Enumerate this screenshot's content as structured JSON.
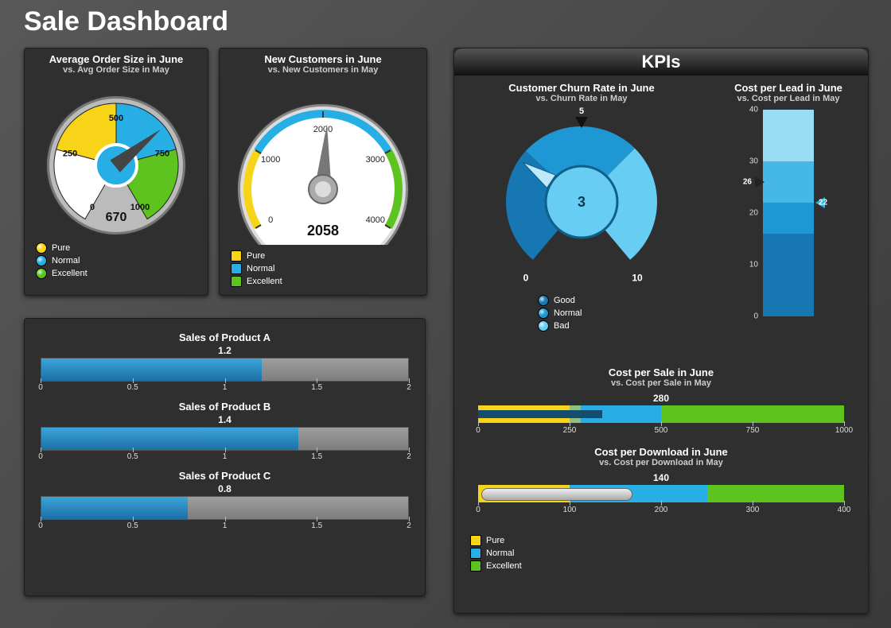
{
  "title": "Sale Dashboard",
  "colors": {
    "pure": "#f7d417",
    "normal": "#27aee5",
    "excellent": "#5cc31f",
    "good": "#1777b2",
    "normal2": "#1f97d4",
    "bad": "#67cdf2"
  },
  "gauge_order": {
    "title": "Average Order Size in June",
    "subtitle": "vs. Avg Order Size in May",
    "min": 0,
    "max": 1000,
    "ticks": [
      0,
      250,
      500,
      750,
      1000
    ],
    "value": 670,
    "bands": [
      {
        "from": 0,
        "to": 250,
        "level": "none"
      },
      {
        "from": 250,
        "to": 500,
        "level": "pure"
      },
      {
        "from": 500,
        "to": 750,
        "level": "normal"
      },
      {
        "from": 750,
        "to": 1000,
        "level": "excellent"
      }
    ],
    "legend": [
      "Pure",
      "Normal",
      "Excellent"
    ]
  },
  "gauge_customers": {
    "title": "New Customers in June",
    "subtitle": "vs. New Customers in May",
    "min": 0,
    "max": 4000,
    "ticks": [
      0,
      1000,
      2000,
      3000,
      4000
    ],
    "value": 2058,
    "bands": [
      {
        "from": 0,
        "to": 1000,
        "level": "pure"
      },
      {
        "from": 1000,
        "to": 3000,
        "level": "normal"
      },
      {
        "from": 3000,
        "to": 4000,
        "level": "excellent"
      }
    ],
    "legend": [
      "Pure",
      "Normal",
      "Excellent"
    ]
  },
  "products": {
    "max": 2,
    "ticks": [
      0,
      0.5,
      1,
      1.5,
      2
    ],
    "items": [
      {
        "name": "Sales of Product A",
        "value": 1.2
      },
      {
        "name": "Sales of Product B",
        "value": 1.4
      },
      {
        "name": "Sales of Product C",
        "value": 0.8
      }
    ]
  },
  "kpi": {
    "title": "KPIs",
    "churn": {
      "title": "Customer Churn Rate in June",
      "subtitle": "vs. Churn Rate in May",
      "min": 0,
      "max": 10,
      "ticks": [
        0,
        5,
        10
      ],
      "value": 3,
      "bands": [
        {
          "from": 0,
          "to": 3.3,
          "level": "good"
        },
        {
          "from": 3.3,
          "to": 6.6,
          "level": "normal2"
        },
        {
          "from": 6.6,
          "to": 10,
          "level": "bad"
        }
      ],
      "legend": [
        "Good",
        "Normal",
        "Bad"
      ]
    },
    "cost_lead": {
      "title": "Cost per Lead in June",
      "subtitle": "vs. Cost per Lead in May",
      "min": 0,
      "max": 40,
      "ticks": [
        0,
        10,
        20,
        30,
        40
      ],
      "left_marker": 26,
      "right_marker": 22,
      "bands": [
        {
          "from": 0,
          "to": 16,
          "color": "#1777b2"
        },
        {
          "from": 16,
          "to": 22,
          "color": "#1f97d4"
        },
        {
          "from": 22,
          "to": 30,
          "color": "#45b8e8"
        },
        {
          "from": 30,
          "to": 40,
          "color": "#9adcf4"
        }
      ]
    },
    "cost_sale": {
      "title": "Cost per Sale in June",
      "subtitle": "vs. Cost per Sale in May",
      "min": 0,
      "max": 1000,
      "ticks": [
        0,
        250,
        500,
        750,
        1000
      ],
      "value": 280,
      "bar_value": 340,
      "bands": [
        {
          "from": 0,
          "to": 250,
          "level": "pure"
        },
        {
          "from": 250,
          "to": 500,
          "level": "normal"
        },
        {
          "from": 500,
          "to": 1000,
          "level": "excellent"
        }
      ]
    },
    "cost_download": {
      "title": "Cost per Download in June",
      "subtitle": "vs. Cost per Download in May",
      "min": 0,
      "max": 400,
      "ticks": [
        0,
        100,
        200,
        300,
        400
      ],
      "value": 140,
      "bar_value": 170,
      "bands": [
        {
          "from": 0,
          "to": 100,
          "level": "pure"
        },
        {
          "from": 100,
          "to": 250,
          "level": "normal"
        },
        {
          "from": 250,
          "to": 400,
          "level": "excellent"
        }
      ]
    },
    "legend": [
      "Pure",
      "Normal",
      "Excellent"
    ]
  },
  "chart_data": [
    {
      "type": "gauge",
      "name": "Average Order Size",
      "value": 670,
      "min": 0,
      "max": 1000,
      "bands": [
        {
          "from": 250,
          "to": 500,
          "label": "Pure"
        },
        {
          "from": 500,
          "to": 750,
          "label": "Normal"
        },
        {
          "from": 750,
          "to": 1000,
          "label": "Excellent"
        }
      ]
    },
    {
      "type": "gauge",
      "name": "New Customers",
      "value": 2058,
      "min": 0,
      "max": 4000,
      "bands": [
        {
          "from": 0,
          "to": 1000,
          "label": "Pure"
        },
        {
          "from": 1000,
          "to": 3000,
          "label": "Normal"
        },
        {
          "from": 3000,
          "to": 4000,
          "label": "Excellent"
        }
      ]
    },
    {
      "type": "bar",
      "name": "Product Sales",
      "categories": [
        "Product A",
        "Product B",
        "Product C"
      ],
      "values": [
        1.2,
        1.4,
        0.8
      ],
      "xlim": [
        0,
        2
      ]
    },
    {
      "type": "gauge",
      "name": "Customer Churn Rate",
      "value": 3,
      "min": 0,
      "max": 10,
      "bands": [
        {
          "from": 0,
          "to": 3.3,
          "label": "Good"
        },
        {
          "from": 3.3,
          "to": 6.6,
          "label": "Normal"
        },
        {
          "from": 6.6,
          "to": 10,
          "label": "Bad"
        }
      ]
    },
    {
      "type": "bullet",
      "name": "Cost per Lead",
      "min": 0,
      "max": 40,
      "markers": [
        26,
        22
      ]
    },
    {
      "type": "bullet",
      "name": "Cost per Sale",
      "min": 0,
      "max": 1000,
      "value": 280,
      "bar": 340
    },
    {
      "type": "bullet",
      "name": "Cost per Download",
      "min": 0,
      "max": 400,
      "value": 140,
      "bar": 170
    }
  ]
}
